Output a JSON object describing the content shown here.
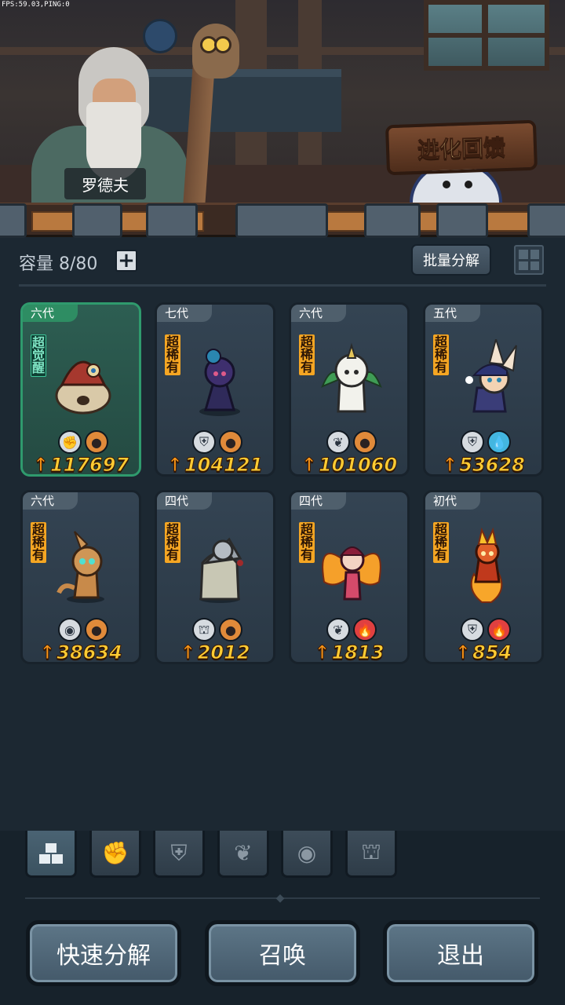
{
  "hud": {
    "fps": "FPS:59.03,PING:0"
  },
  "header": {
    "npc_name": "罗德夫",
    "evolve_button": "进化回馈"
  },
  "toolbar": {
    "capacity_label": "容量 8/80",
    "add_symbol": "+",
    "batch_decompose": "批量分解"
  },
  "cards": [
    {
      "gen": "六代",
      "rarity": "超觉醒",
      "power": "117697",
      "class_icon": "fist-icon",
      "element": "earth",
      "featured": true
    },
    {
      "gen": "七代",
      "rarity": "超稀有",
      "power": "104121",
      "class_icon": "shield-icon",
      "element": "earth"
    },
    {
      "gen": "六代",
      "rarity": "超稀有",
      "power": "101060",
      "class_icon": "sprout-icon",
      "element": "earth"
    },
    {
      "gen": "五代",
      "rarity": "超稀有",
      "power": "53628",
      "class_icon": "shield-icon",
      "element": "water"
    },
    {
      "gen": "六代",
      "rarity": "超稀有",
      "power": "38634",
      "class_icon": "alien-icon",
      "element": "earth"
    },
    {
      "gen": "四代",
      "rarity": "超稀有",
      "power": "2012",
      "class_icon": "helm-icon",
      "element": "earth"
    },
    {
      "gen": "四代",
      "rarity": "超稀有",
      "power": "1813",
      "class_icon": "sprout-icon",
      "element": "fire"
    },
    {
      "gen": "初代",
      "rarity": "超稀有",
      "power": "854",
      "class_icon": "shield-icon",
      "element": "fire"
    }
  ],
  "filter_tabs": [
    {
      "icon": "all-blocks-icon",
      "active": true
    },
    {
      "icon": "fist-icon"
    },
    {
      "icon": "shield-icon"
    },
    {
      "icon": "sprout-icon"
    },
    {
      "icon": "alien-icon"
    },
    {
      "icon": "helm-icon"
    }
  ],
  "actions": {
    "quick_decompose": "快速分解",
    "summon": "召唤",
    "exit": "退出"
  },
  "colors": {
    "rarity": "#f5a623",
    "awake": "#3ec79a",
    "power": "#ffcc33",
    "earth": "#e08a3a",
    "water": "#43b6e0",
    "fire": "#e04040"
  }
}
